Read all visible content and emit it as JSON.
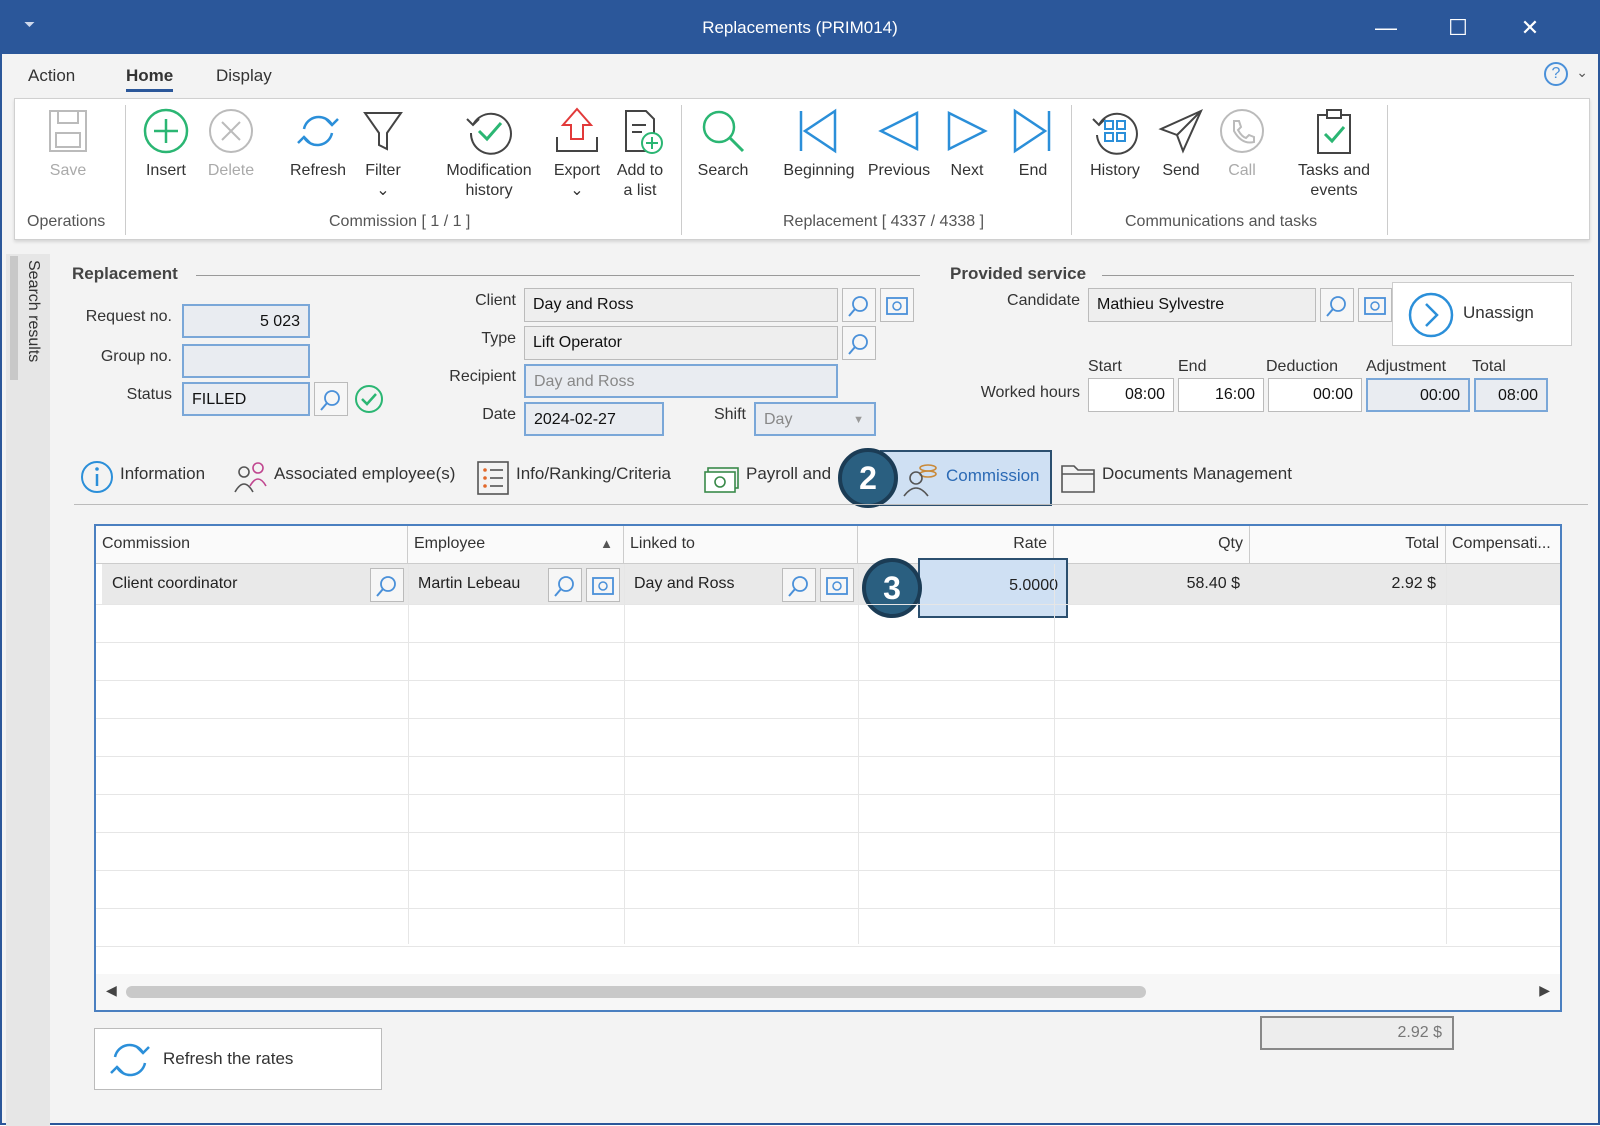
{
  "window": {
    "title": "Replacements (PRIM014)",
    "quick_access": "⏷",
    "minimize": "—",
    "maximize": "☐",
    "close": "✕"
  },
  "menu": {
    "items": [
      "Action",
      "Home",
      "Display"
    ],
    "active": "Home",
    "help": "?",
    "help_dropdown": "⌄"
  },
  "ribbon": {
    "save": "Save",
    "operations_label": "Operations",
    "insert": "Insert",
    "delete": "Delete",
    "refresh": "Refresh",
    "filter": "Filter",
    "dropdown_caret": "⌄",
    "modification_history_1": "Modification",
    "modification_history_2": "history",
    "export": "Export",
    "add_to_list_1": "Add to",
    "add_to_list_2": "a list",
    "commission_group_label": "Commission [ 1 / 1 ]",
    "search": "Search",
    "beginning": "Beginning",
    "previous": "Previous",
    "next": "Next",
    "end": "End",
    "replacement_group_label": "Replacement [ 4337 / 4338 ]",
    "history": "History",
    "send": "Send",
    "call": "Call",
    "tasks_events_1": "Tasks and",
    "tasks_events_2": "events",
    "communications_group_label": "Communications and tasks"
  },
  "sidebar": {
    "label": "Search results"
  },
  "replacement": {
    "section_title": "Replacement",
    "request_no_label": "Request no.",
    "request_no": "5 023",
    "group_no_label": "Group no.",
    "group_no": "",
    "status_label": "Status",
    "status": "FILLED",
    "client_label": "Client",
    "client": "Day and Ross",
    "type_label": "Type",
    "type": "Lift Operator",
    "recipient_label": "Recipient",
    "recipient": "Day and Ross",
    "date_label": "Date",
    "date": "2024-02-27",
    "shift_label": "Shift",
    "shift": "Day"
  },
  "provided_service": {
    "section_title": "Provided service",
    "candidate_label": "Candidate",
    "candidate": "Mathieu Sylvestre",
    "unassign": "Unassign",
    "worked_hours_label": "Worked hours",
    "start_label": "Start",
    "start": "08:00",
    "end_label": "End",
    "end": "16:00",
    "deduction_label": "Deduction",
    "deduction": "00:00",
    "adjustment_label": "Adjustment",
    "adjustment": "00:00",
    "total_label": "Total",
    "total": "08:00"
  },
  "tabs": {
    "information": "Information",
    "associated": "Associated employee(s)",
    "info_ranking": "Info/Ranking/Criteria",
    "payroll": "Payroll and",
    "commission": "Commission",
    "documents": "Documents Management",
    "active": "Commission"
  },
  "badges": {
    "tab_step": "2",
    "rate_step": "3"
  },
  "grid": {
    "columns": [
      "Commission",
      "Employee",
      "Linked to",
      "Rate",
      "Qty",
      "Total",
      "Compensati..."
    ],
    "sorted_column": "Employee",
    "sort_indicator": "▲",
    "rows": [
      {
        "commission": "Client coordinator",
        "employee": "Martin Lebeau",
        "linked_to": "Day and Ross",
        "rate": "5.0000",
        "qty": "58.40 $",
        "total": "2.92 $",
        "compensation": ""
      }
    ],
    "scroll_left": "◀",
    "scroll_right": "▶",
    "sum_total": "2.92 $"
  },
  "refresh_rates": "Refresh the rates",
  "colors": {
    "accent": "#2b579a",
    "badge": "#2a5f80",
    "tab_active_bg": "#cfe0f3",
    "icon_green": "#2bb673",
    "icon_blue": "#2b8fd9"
  }
}
